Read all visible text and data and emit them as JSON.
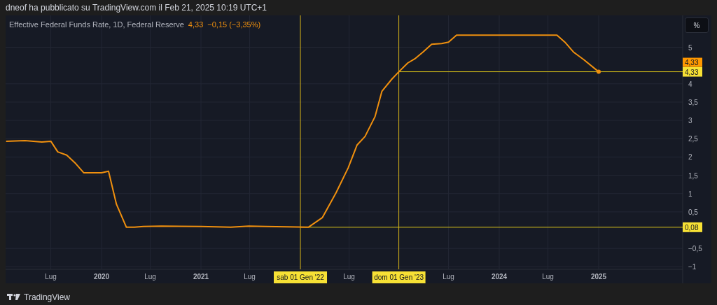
{
  "header": {
    "byline": "dneof ha pubblicato su TradingView.com il Feb 21, 2025 10:19 UTC+1"
  },
  "legend": {
    "value": "4,33",
    "change": "−0,15 (−3,35%)"
  },
  "last_price_label": {
    "text": "4,33",
    "color": "#ff9800"
  },
  "scale_button": "%",
  "chart_data": {
    "type": "line",
    "x": [
      2019.04,
      2019.23,
      2019.4,
      2019.49,
      2019.56,
      2019.65,
      2019.74,
      2019.82,
      2020.0,
      2020.07,
      2020.15,
      2020.25,
      2020.33,
      2020.42,
      2020.6,
      2021.0,
      2021.3,
      2021.48,
      2021.65,
      2022.08,
      2022.22,
      2022.36,
      2022.48,
      2022.57,
      2022.65,
      2022.75,
      2022.82,
      2022.92,
      2022.99,
      2023.08,
      2023.15,
      2023.23,
      2023.32,
      2023.42,
      2023.49,
      2023.57,
      2024.58,
      2024.66,
      2024.75,
      2024.85,
      2025.0
    ],
    "series": [
      {
        "name": "Effective Federal Funds Rate, 1D, Federal Reserve",
        "color": "#f0900e",
        "values": [
          2.43,
          2.45,
          2.41,
          2.43,
          2.14,
          2.05,
          1.82,
          1.57,
          1.57,
          1.61,
          0.71,
          0.08,
          0.08,
          0.1,
          0.11,
          0.1,
          0.08,
          0.11,
          0.1,
          0.08,
          0.34,
          1.03,
          1.7,
          2.33,
          2.56,
          3.1,
          3.8,
          4.13,
          4.33,
          4.57,
          4.68,
          4.86,
          5.08,
          5.1,
          5.14,
          5.33,
          5.33,
          5.14,
          4.86,
          4.66,
          4.33
        ]
      }
    ],
    "xlim": [
      2019.035,
      2025.845
    ],
    "ylim": [
      -1.07,
      5.87
    ],
    "xticks": [
      {
        "value": 2019.49,
        "label": "Lug"
      },
      {
        "value": 2020,
        "label": "2020"
      },
      {
        "value": 2020.49,
        "label": "Lug"
      },
      {
        "value": 2021,
        "label": "2021"
      },
      {
        "value": 2021.49,
        "label": "Lug"
      },
      {
        "value": 2022.49,
        "label": "Lug"
      },
      {
        "value": 2023.49,
        "label": "Lug"
      },
      {
        "value": 2024,
        "label": "2024"
      },
      {
        "value": 2024.49,
        "label": "Lug"
      },
      {
        "value": 2025,
        "label": "2025"
      }
    ],
    "yticks": [
      {
        "value": -1,
        "label": "−1"
      },
      {
        "value": -0.5,
        "label": "−0,5"
      },
      {
        "value": 0.5,
        "label": "0,5"
      },
      {
        "value": 1,
        "label": "1"
      },
      {
        "value": 1.5,
        "label": "1,5"
      },
      {
        "value": 2,
        "label": "2"
      },
      {
        "value": 2.5,
        "label": "2,5"
      },
      {
        "value": 3,
        "label": "3"
      },
      {
        "value": 3.5,
        "label": "3,5"
      },
      {
        "value": 4,
        "label": "4"
      },
      {
        "value": 5,
        "label": "5"
      }
    ],
    "grid": true,
    "ref_lines": [
      {
        "axis": "x",
        "value": 2022.0,
        "label": "sab 01 Gen '22"
      },
      {
        "axis": "x",
        "value": 2022.99,
        "label": "dom 01 Gen '23"
      },
      {
        "axis": "y",
        "value": 4.33,
        "label": "4,33"
      },
      {
        "axis": "y",
        "value": 0.08,
        "label": "0,08"
      }
    ]
  },
  "footer": {
    "brand": "TradingView"
  }
}
